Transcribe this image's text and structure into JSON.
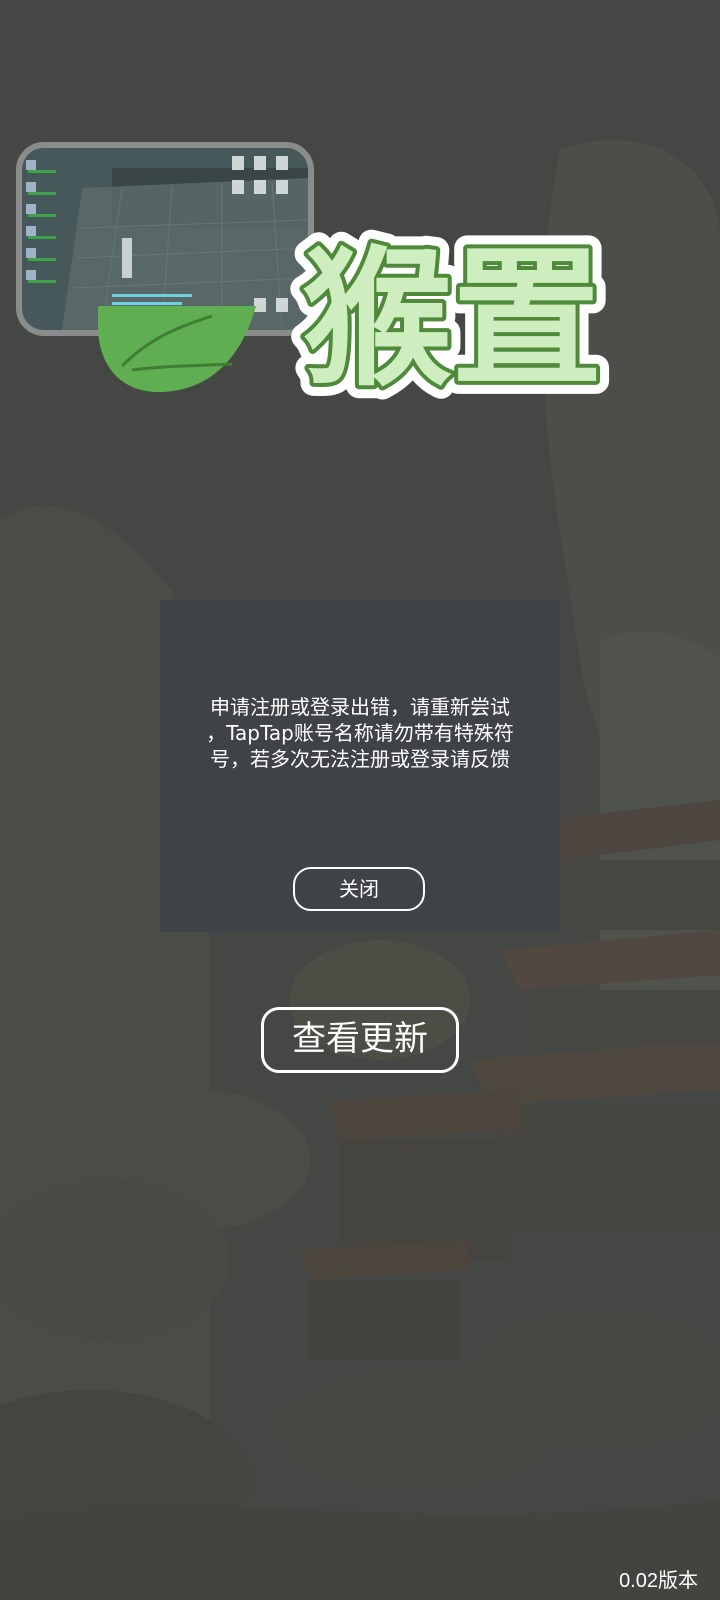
{
  "logo": {
    "title_text": "猴置",
    "fill_color": "#cfeec0",
    "stroke_color": "#4e8a3a",
    "leaf_color": "#5fae52"
  },
  "dialog": {
    "message": "申请注册或登录出错，请重新尝试，TapTap账号名称请勿带有特殊符号，若多次无法注册或登录请反馈",
    "message_lines": [
      "申请注册或登录出错，请重新尝试",
      "，TapTap账号名称请勿带有特殊符",
      "号，若多次无法注册或登录请反馈"
    ],
    "close_label": "关闭"
  },
  "update_button_label": "查看更新",
  "version_text": "0.02版本",
  "colors": {
    "dialog_bg": "#3f4246",
    "page_bg": "#4a4b48"
  }
}
